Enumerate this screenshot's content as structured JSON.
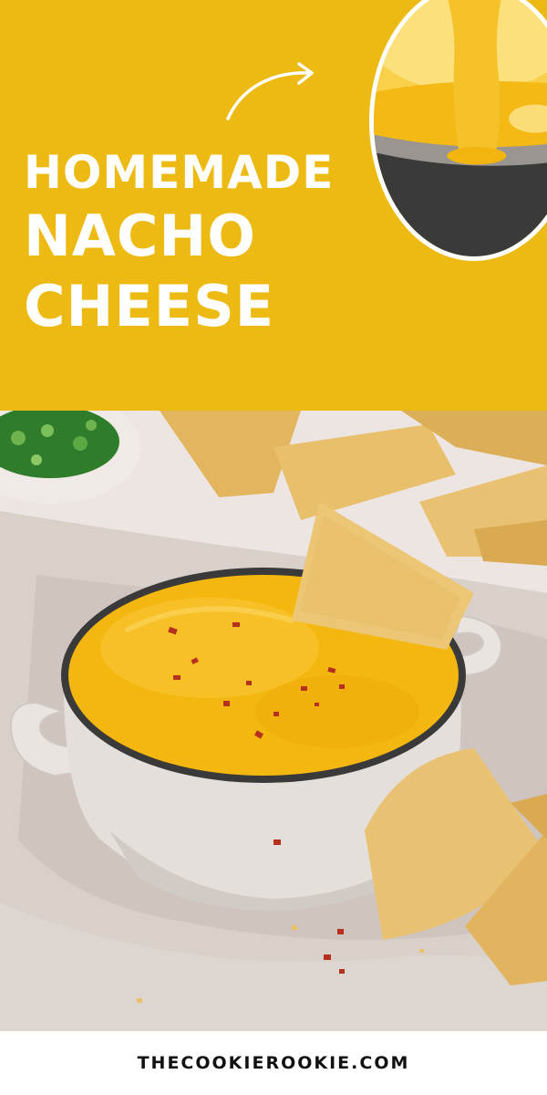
{
  "title": {
    "line1": "HOMEMADE",
    "line2": "NACHO",
    "line3": "CHEESE"
  },
  "footer": {
    "site": "THECOOKIEROOKIE.COM"
  },
  "colors": {
    "banner": "#ecba12",
    "title_text": "#ffffff",
    "cheese": "#f4b70f",
    "footer_text": "#111111"
  },
  "icons": {
    "arrow": "curved-arrow-icon"
  }
}
